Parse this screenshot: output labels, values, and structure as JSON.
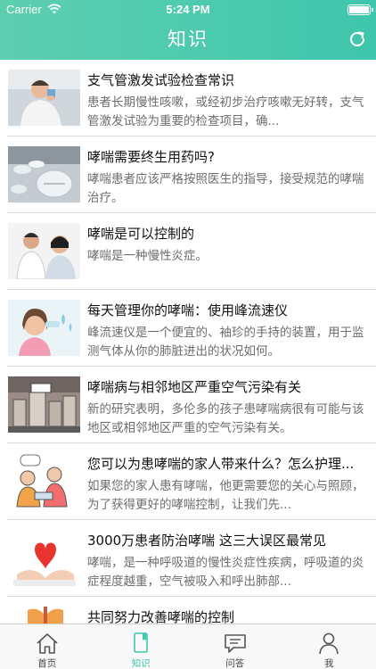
{
  "status": {
    "carrier": "Carrier",
    "time": "5:24 PM"
  },
  "header": {
    "title": "知识"
  },
  "articles": [
    {
      "title": "支气管激发试验检查常识",
      "summary": "患者长期慢性咳嗽，或经初步治疗咳嗽无好转，支气管激发试验为重要的检查项目，确..."
    },
    {
      "title": "哮喘需要终生用药吗?",
      "summary": "哮喘患者应该严格按照医生的指导，接受规范的哮喘治疗。"
    },
    {
      "title": "哮喘是可以控制的",
      "summary": "哮喘是一种慢性炎症。"
    },
    {
      "title": "每天管理你的哮喘：使用峰流速仪",
      "summary": "峰流速仪是一个便宜的、袖珍的手持的装置，用于监测气体从你的肺脏进出的状况如何。"
    },
    {
      "title": "哮喘病与相邻地区严重空气污染有关",
      "summary": "新的研究表明，多伦多的孩子患哮喘病很有可能与该地区或相邻地区严重的空气污染有关。"
    },
    {
      "title": "您可以为患哮喘的家人带来什么？怎么护理...",
      "summary": "如果您的家人患有哮喘，他更需要您的关心与照顾，为了获得更好的哮喘控制，让我们先..."
    },
    {
      "title": "3000万患者防治哮喘 这三大误区最常见",
      "summary": "哮喘，是一种呼吸道的慢性炎症性疾病，呼吸道的炎症程度越重，空气被吸入和呼出肺部..."
    },
    {
      "title": "共同努力改善哮喘的控制",
      "summary": ""
    }
  ],
  "tabs": [
    {
      "label": "首页"
    },
    {
      "label": "知识"
    },
    {
      "label": "问答"
    },
    {
      "label": "我"
    }
  ],
  "colors": {
    "accent": "#3fc6ad",
    "header_start": "#5dcfae"
  }
}
